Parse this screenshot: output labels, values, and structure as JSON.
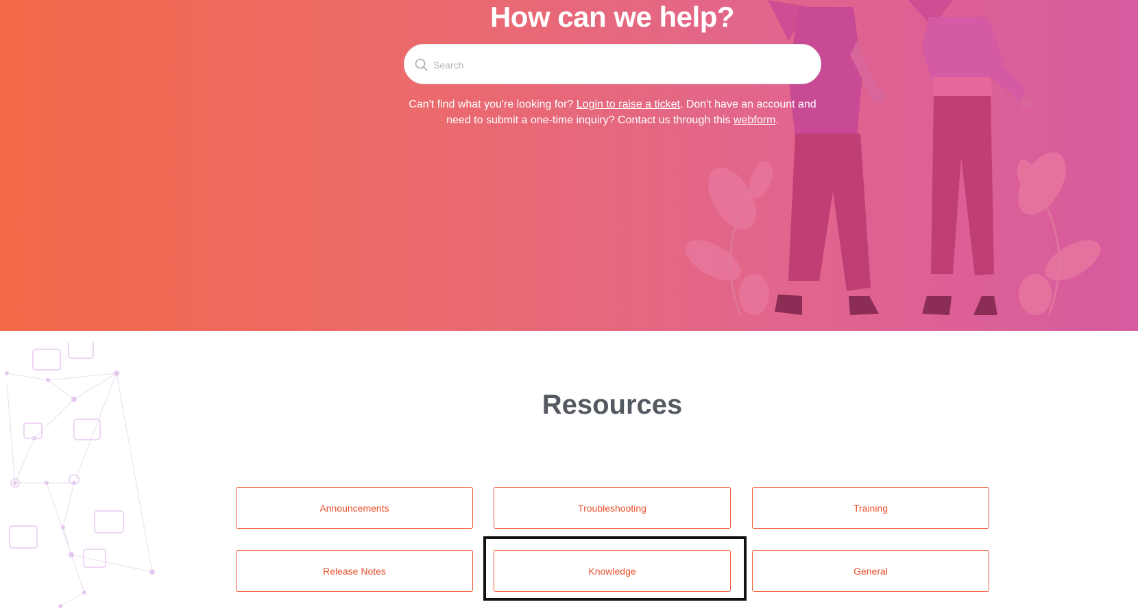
{
  "hero": {
    "title": "How can we help?",
    "search": {
      "placeholder": "Search",
      "value": ""
    },
    "help_text": {
      "part1": "Can't find what you're looking for? ",
      "login_link": "Login to raise a ticket",
      "part2": ". Don't have an account and need to submit a one-time inquiry? Contact us through this ",
      "webform_link": "webform",
      "part3": "."
    }
  },
  "resources": {
    "title": "Resources",
    "buttons": [
      {
        "label": "Announcements"
      },
      {
        "label": "Troubleshooting"
      },
      {
        "label": "Training"
      },
      {
        "label": "Release Notes"
      },
      {
        "label": "Knowledge"
      },
      {
        "label": "General"
      }
    ]
  },
  "colors": {
    "accent": "#ef5a35",
    "hero_start": "#f26947",
    "hero_end": "#d75b9f"
  },
  "icons": [
    "search-icon"
  ]
}
